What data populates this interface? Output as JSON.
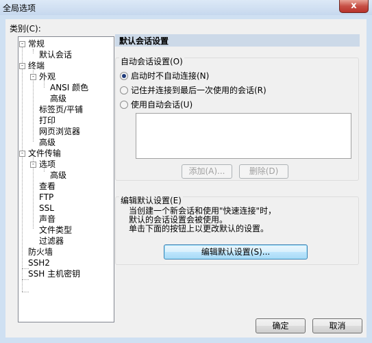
{
  "window": {
    "title": "全局选项",
    "close_label": "x"
  },
  "category": {
    "label": "类别(C):",
    "tree": [
      {
        "label": "常规"
      },
      {
        "label": "默认会话"
      },
      {
        "label": "终端"
      },
      {
        "label": "外观"
      },
      {
        "label": "ANSI 颜色"
      },
      {
        "label": "高级"
      },
      {
        "label": "标签页/平铺"
      },
      {
        "label": "打印"
      },
      {
        "label": "网页浏览器"
      },
      {
        "label": "高级"
      },
      {
        "label": "文件传输"
      },
      {
        "label": "选项"
      },
      {
        "label": "高级"
      },
      {
        "label": "查看"
      },
      {
        "label": "FTP"
      },
      {
        "label": "SSL"
      },
      {
        "label": "声音"
      },
      {
        "label": "文件类型"
      },
      {
        "label": "过滤器"
      },
      {
        "label": "防火墙"
      },
      {
        "label": "SSH2"
      },
      {
        "label": "SSH 主机密钥"
      }
    ],
    "expander_symbol": "-"
  },
  "panel": {
    "header": "默认会话设置",
    "auto_session": {
      "label": "自动会话设置(O)",
      "options": [
        {
          "label": "启动时不自动连接(N)",
          "checked": true
        },
        {
          "label": "记住并连接到最后一次使用的会话(R)",
          "checked": false
        },
        {
          "label": "使用自动会话(U)",
          "checked": false
        }
      ],
      "add_button": "添加(A)...",
      "delete_button": "删除(D)"
    },
    "edit_default": {
      "label": "编辑默认设置(E)",
      "description": [
        "当创建一个新会话和使用\"快速连接\"时，",
        "默认的会话设置会被使用。",
        "单击下面的按钮上以更改默认的设置。"
      ],
      "button": "编辑默认设置(S)..."
    }
  },
  "footer": {
    "ok_button": "确定",
    "cancel_button": "取消"
  }
}
